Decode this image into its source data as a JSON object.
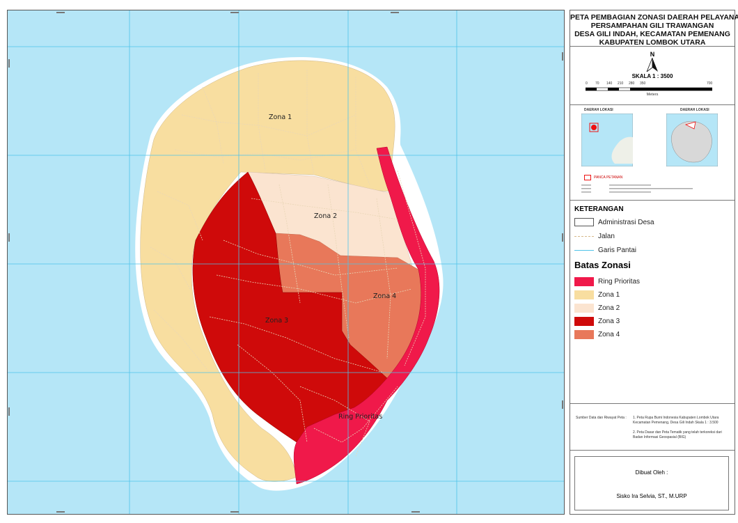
{
  "title": {
    "line1": "PETA PEMBAGIAN ZONASI DAERAH PELAYANAN",
    "line2": "PERSAMPAHAN GILI TRAWANGAN",
    "line3": "DESA GILI INDAH, KECAMATAN PEMENANG",
    "line4": "KABUPATEN LOMBOK UTARA"
  },
  "north": "N",
  "scale": {
    "label": "SKALA 1 : 3500",
    "ticks": [
      "0",
      "70",
      "140",
      "210",
      "280",
      "350",
      "700"
    ],
    "unit": "Meters"
  },
  "insets": {
    "left_title": "DAERAH LOKASI",
    "right_title": "DAERAH LOKASI",
    "marker_label": "PANCA PETANAN"
  },
  "legend": {
    "heading": "KETERANGAN",
    "base": [
      {
        "label": "Administrasi Desa",
        "kind": "box"
      },
      {
        "label": "Jalan",
        "kind": "road"
      },
      {
        "label": "Garis Pantai",
        "kind": "coast"
      }
    ],
    "zone_heading": "Batas Zonasi",
    "zones": [
      {
        "label": "Ring Prioritas",
        "color": "#f0194a"
      },
      {
        "label": "Zona 1",
        "color": "#f8dea0"
      },
      {
        "label": "Zona 2",
        "color": "#fbe4d0"
      },
      {
        "label": "Zona 3",
        "color": "#cf0a0a"
      },
      {
        "label": "Zona 4",
        "color": "#e8785a"
      }
    ]
  },
  "sources": {
    "label": "Sumber Data dan Riwayat Peta :",
    "item1": "1. Peta Rupa Bumi Indonesia Kabupaten Lombok Utara Kecamatan Pemenang, Desa Gili Indah Skala 1 : 3.500",
    "item2": "2. Peta Dasar dan Peta Tematik yang telah terkoreksi dari Badan Informasi Geospasial (BIG)"
  },
  "credits": {
    "made_by": "Dibuat Oleh :",
    "author": "Sisko Ira Selvia, ST., M.URP"
  },
  "map_labels": {
    "zona1": "Zona 1",
    "zona2": "Zona 2",
    "zona3": "Zona 3",
    "zona4": "Zona 4",
    "ring": "Ring Prioritas"
  },
  "colors": {
    "sea": "#b5e6f7",
    "ring": "#f0194a",
    "zona1": "#f8dea0",
    "zona2": "#fbe4d0",
    "zona3": "#cf0a0a",
    "zona4": "#e8785a",
    "grid": "#4fc3e8"
  }
}
